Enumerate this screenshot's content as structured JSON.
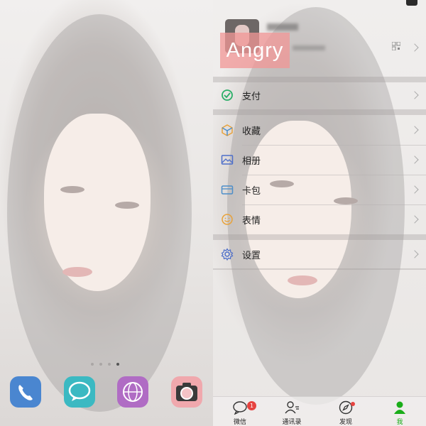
{
  "home": {
    "page_dots": 4,
    "active_dot": 3,
    "dock": [
      {
        "name": "phone",
        "icon": "phone-icon",
        "color": "#4a86d0"
      },
      {
        "name": "messages",
        "icon": "message-bubble-icon",
        "color": "#3bb9c2"
      },
      {
        "name": "browser",
        "icon": "globe-icon",
        "color": "#b06cc4"
      },
      {
        "name": "camera",
        "icon": "camera-icon",
        "color": "#f0a8ad"
      }
    ]
  },
  "wechat": {
    "profile": {
      "overlay_text": "Angry",
      "qr_icon": "qr-code-icon"
    },
    "menu": [
      {
        "label": "支付",
        "icon": "pay-check-icon",
        "color": "#2aae67"
      },
      {
        "label": "收藏",
        "icon": "cube-icon",
        "color": "#e8a23a"
      },
      {
        "label": "相册",
        "icon": "picture-icon",
        "color": "#4d6ec9"
      },
      {
        "label": "卡包",
        "icon": "wallet-icon",
        "color": "#4d8ec9"
      },
      {
        "label": "表情",
        "icon": "smiley-icon",
        "color": "#e8a23a"
      },
      {
        "label": "设置",
        "icon": "gear-icon",
        "color": "#4d6ec9"
      }
    ],
    "tabs": [
      {
        "label": "微信",
        "icon": "chat-bubble-icon",
        "badge": "1",
        "active": false
      },
      {
        "label": "通讯录",
        "icon": "contacts-icon",
        "active": false
      },
      {
        "label": "发现",
        "icon": "compass-icon",
        "dot": true,
        "active": false
      },
      {
        "label": "我",
        "icon": "person-icon",
        "active": true
      }
    ],
    "colors": {
      "active_tab": "#1aad19",
      "badge": "#e64340"
    }
  }
}
